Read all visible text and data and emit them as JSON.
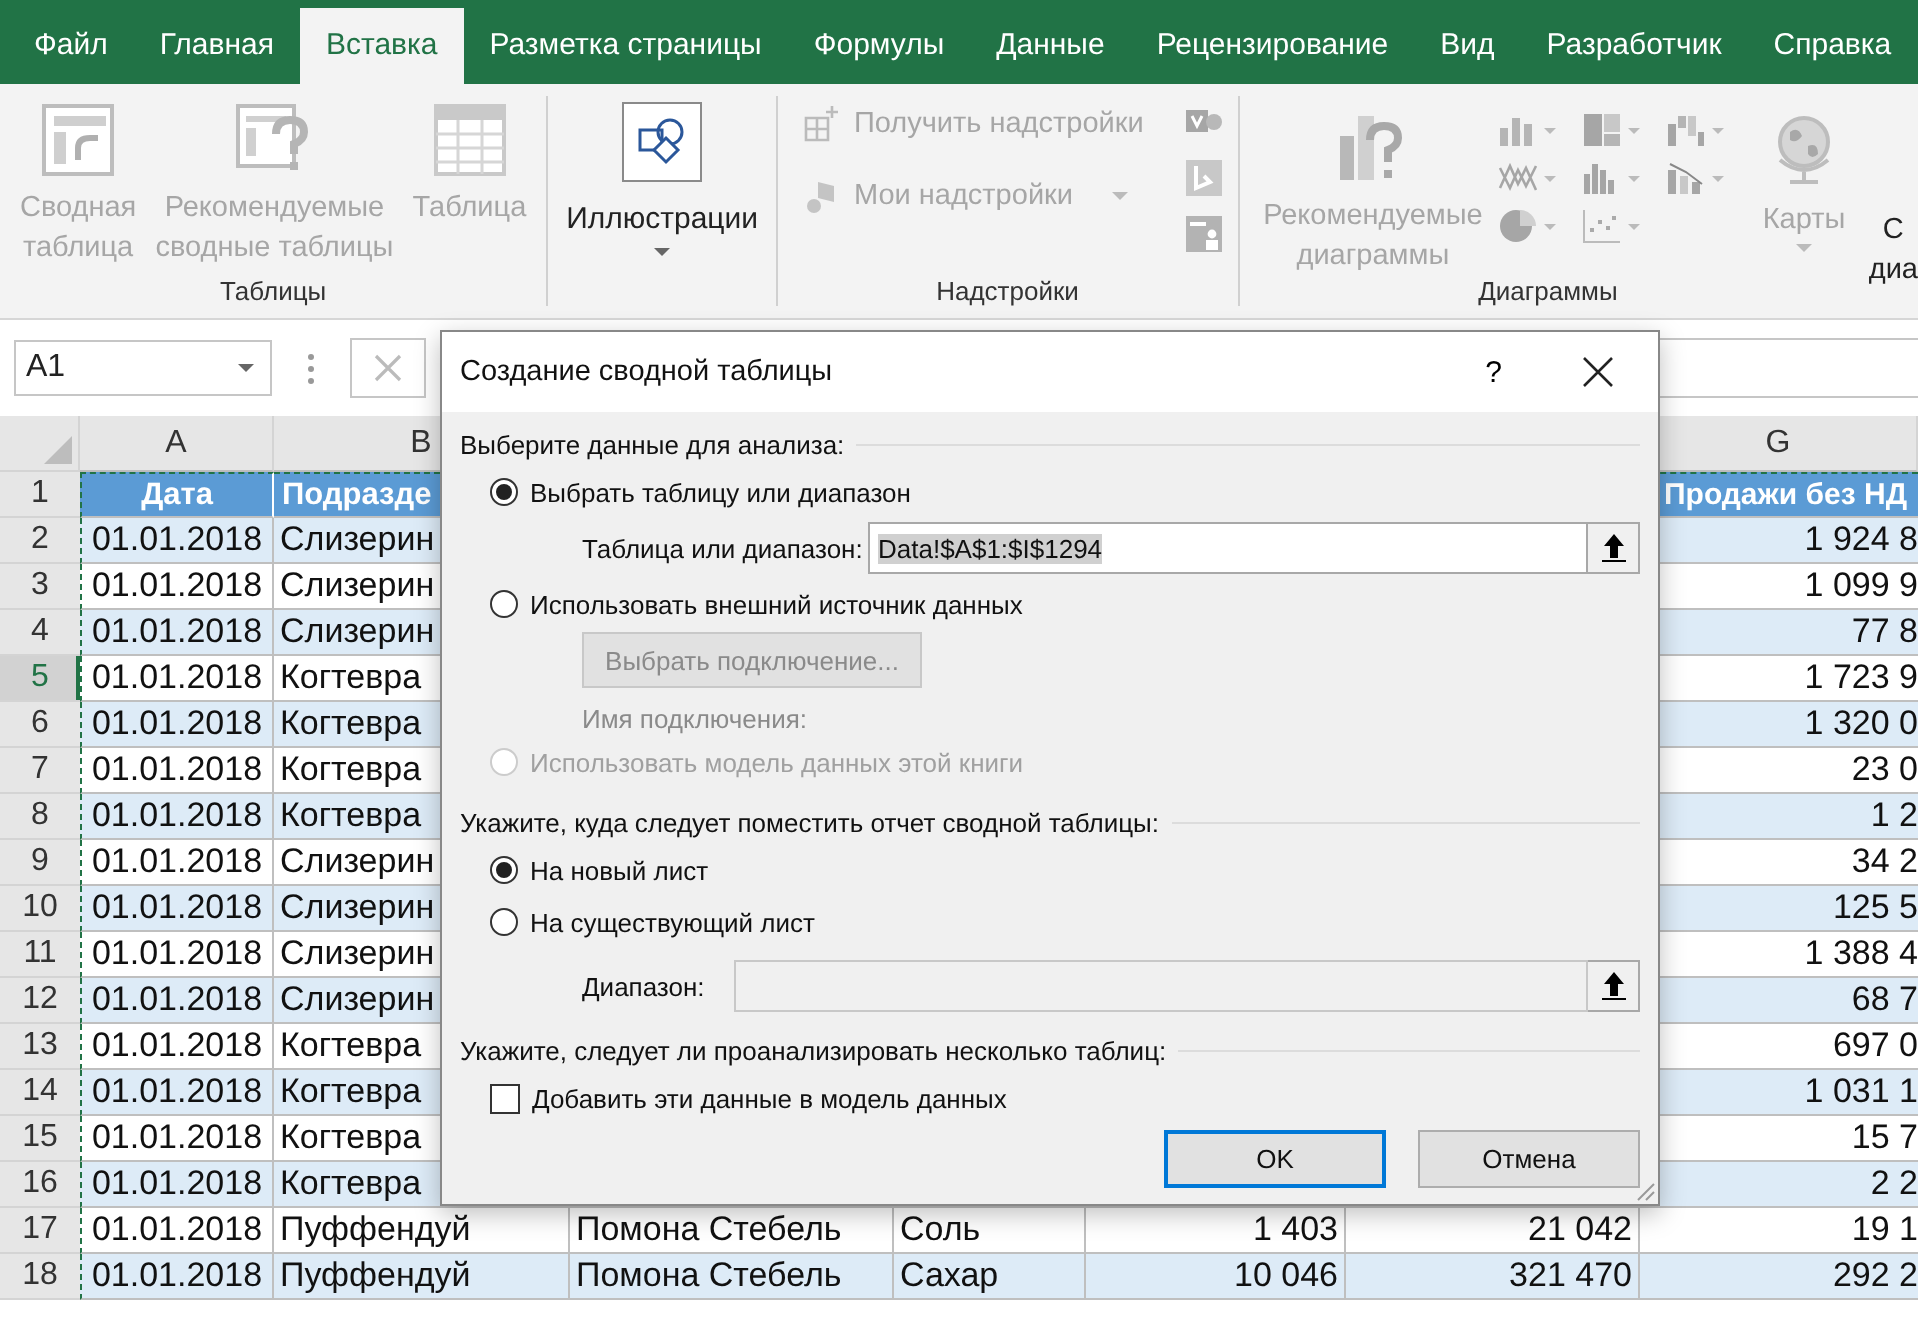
{
  "tabs": [
    {
      "label": "Файл",
      "selected": false
    },
    {
      "label": "Главная",
      "selected": false
    },
    {
      "label": "Вставка",
      "selected": true
    },
    {
      "label": "Разметка страницы",
      "selected": false
    },
    {
      "label": "Формулы",
      "selected": false
    },
    {
      "label": "Данные",
      "selected": false
    },
    {
      "label": "Рецензирование",
      "selected": false
    },
    {
      "label": "Вид",
      "selected": false
    },
    {
      "label": "Разработчик",
      "selected": false
    },
    {
      "label": "Справка",
      "selected": false
    }
  ],
  "ribbon": {
    "tables": {
      "label": "Таблицы",
      "items": [
        {
          "lines": [
            "Сводная",
            "таблица"
          ],
          "disabled": true
        },
        {
          "lines": [
            "Рекомендуемые",
            "сводные таблицы"
          ],
          "disabled": true
        },
        {
          "lines": [
            "Таблица"
          ],
          "disabled": true
        }
      ]
    },
    "illustrations": {
      "label": "Иллюстрации"
    },
    "addins": {
      "label": "Надстройки",
      "items": [
        {
          "label": "Получить надстройки",
          "disabled": true
        },
        {
          "label": "Мои надстройки",
          "disabled": true
        }
      ]
    },
    "charts": {
      "label": "Диаграммы",
      "recommended": {
        "lines": [
          "Рекомендуемые",
          "диаграммы"
        ],
        "disabled": true
      },
      "maps": {
        "label": "Карты",
        "disabled": true
      }
    },
    "cut_item": {
      "lines": [
        "С",
        "диа"
      ]
    }
  },
  "formula_bar": {
    "name_box": "A1"
  },
  "sheet": {
    "columns": [
      {
        "label": "A"
      },
      {
        "label": "B"
      },
      {
        "label": "G"
      }
    ],
    "rows": [
      {
        "number": "1",
        "kind": "header",
        "selected": false,
        "a": "Дата",
        "b": "Подразде",
        "g": "Продажи без НД"
      },
      {
        "number": "2",
        "kind": "data",
        "selected": false,
        "a": "01.01.2018",
        "b": "Слизерин",
        "g": "1 924 8"
      },
      {
        "number": "3",
        "kind": "data",
        "selected": false,
        "a": "01.01.2018",
        "b": "Слизерин",
        "g": "1 099 9"
      },
      {
        "number": "4",
        "kind": "data",
        "selected": false,
        "a": "01.01.2018",
        "b": "Слизерин",
        "g": "77 8"
      },
      {
        "number": "5",
        "kind": "data",
        "selected": true,
        "a": "01.01.2018",
        "b": "Когтевра",
        "g": "1 723 9"
      },
      {
        "number": "6",
        "kind": "data",
        "selected": false,
        "a": "01.01.2018",
        "b": "Когтевра",
        "g": "1 320 0"
      },
      {
        "number": "7",
        "kind": "data",
        "selected": false,
        "a": "01.01.2018",
        "b": "Когтевра",
        "g": "23 0"
      },
      {
        "number": "8",
        "kind": "data",
        "selected": false,
        "a": "01.01.2018",
        "b": "Когтевра",
        "g": "1 2"
      },
      {
        "number": "9",
        "kind": "data",
        "selected": false,
        "a": "01.01.2018",
        "b": "Слизерин",
        "g": "34 2"
      },
      {
        "number": "10",
        "kind": "data",
        "selected": false,
        "a": "01.01.2018",
        "b": "Слизерин",
        "g": "125 5"
      },
      {
        "number": "11",
        "kind": "data",
        "selected": false,
        "a": "01.01.2018",
        "b": "Слизерин",
        "g": "1 388 4"
      },
      {
        "number": "12",
        "kind": "data",
        "selected": false,
        "a": "01.01.2018",
        "b": "Слизерин",
        "g": "68 7"
      },
      {
        "number": "13",
        "kind": "data",
        "selected": false,
        "a": "01.01.2018",
        "b": "Когтевра",
        "g": "697 0"
      },
      {
        "number": "14",
        "kind": "data",
        "selected": false,
        "a": "01.01.2018",
        "b": "Когтевра",
        "g": "1 031 1"
      },
      {
        "number": "15",
        "kind": "data",
        "selected": false,
        "a": "01.01.2018",
        "b": "Когтевра",
        "g": "15 7"
      },
      {
        "number": "16",
        "kind": "data",
        "selected": false,
        "a": "01.01.2018",
        "b": "Когтевра",
        "g": "2 2"
      },
      {
        "number": "17",
        "kind": "data",
        "selected": false,
        "a": "01.01.2018",
        "b": "Пуффендуй",
        "c": "Помона Стебель",
        "d": "Соль",
        "e": "1 403",
        "f": "21 042",
        "g": "19 1"
      },
      {
        "number": "18",
        "kind": "data",
        "selected": false,
        "a": "01.01.2018",
        "b": "Пуффендуй",
        "c": "Помона Стебель",
        "d": "Сахар",
        "e": "10 046",
        "f": "321 470",
        "g": "292 2"
      }
    ]
  },
  "dialog": {
    "title": "Создание сводной таблицы",
    "help": "?",
    "source_heading": "Выберите данные для анализа:",
    "source_options": [
      {
        "label": "Выбрать таблицу или диапазон",
        "selected": true,
        "disabled": false
      },
      {
        "label": "Использовать внешний источник данных",
        "selected": false,
        "disabled": false
      },
      {
        "label": "Использовать модель данных этой книги",
        "selected": false,
        "disabled": true
      }
    ],
    "range_field": {
      "label": "Таблица или диапазон:",
      "value": "Data!$A$1:$I$1294",
      "highlighted": true
    },
    "connection_button": {
      "label": "Выбрать подключение...",
      "disabled": true
    },
    "connection_name": {
      "label": "Имя подключения:",
      "disabled": true
    },
    "destination_heading": "Укажите, куда следует поместить отчет сводной таблицы:",
    "destination_options": [
      {
        "label": "На новый лист",
        "selected": true
      },
      {
        "label": "На существующий лист",
        "selected": false
      }
    ],
    "destination_field": {
      "label": "Диапазон:",
      "disabled": true
    },
    "tables_heading": "Укажите, следует ли проанализировать несколько таблиц:",
    "data_model_checkbox": {
      "label": "Добавить эти данные в модель данных",
      "checked": false
    },
    "buttons": [
      {
        "label": "OK",
        "default": true
      },
      {
        "label": "Отмена",
        "default": false
      }
    ]
  }
}
